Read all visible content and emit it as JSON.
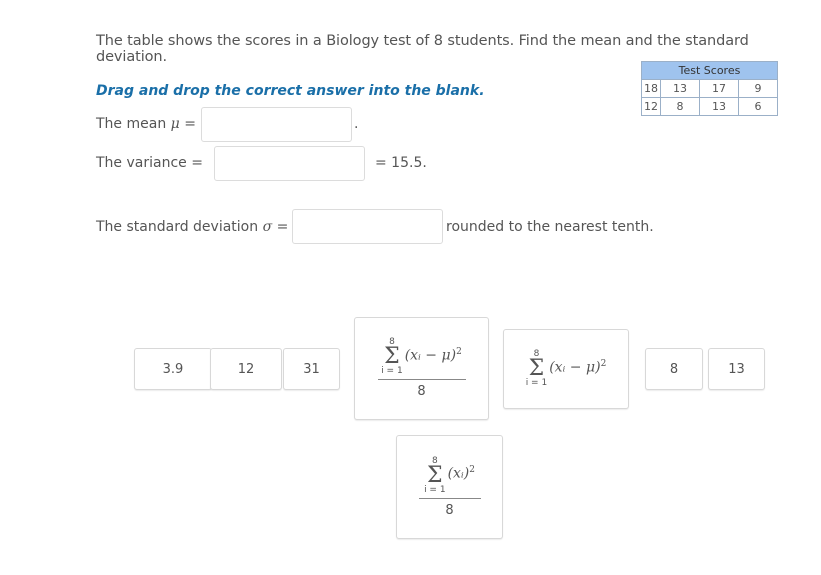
{
  "question": {
    "intro": "The table shows the scores in a Biology test of 8 students. Find the mean and the standard deviation.",
    "instruction": "Drag and drop the correct answer into the blank."
  },
  "table": {
    "header": "Test Scores",
    "rows": [
      [
        "18",
        "13",
        "17",
        "9"
      ],
      [
        "12",
        "8",
        "13",
        "6"
      ]
    ]
  },
  "mean": {
    "label": "The mean",
    "symbol": "μ",
    "eq": "=",
    "period": "."
  },
  "variance": {
    "label": "The variance",
    "eq": "=",
    "result": "= 15.5."
  },
  "sd": {
    "label": "The standard deviation",
    "symbol": "σ",
    "eq": "=",
    "suffix": "rounded to the nearest tenth."
  },
  "choices": {
    "a": "3.9",
    "b": "12",
    "c": "31",
    "d": "8",
    "e": "13",
    "formula_upper": "8",
    "formula_lower": "i = 1",
    "formula_sigma": "Σ",
    "formula_expr_mu": "(xᵢ − μ)",
    "formula_expr_x": "(xᵢ)",
    "formula_power": "2",
    "formula_den": "8"
  }
}
